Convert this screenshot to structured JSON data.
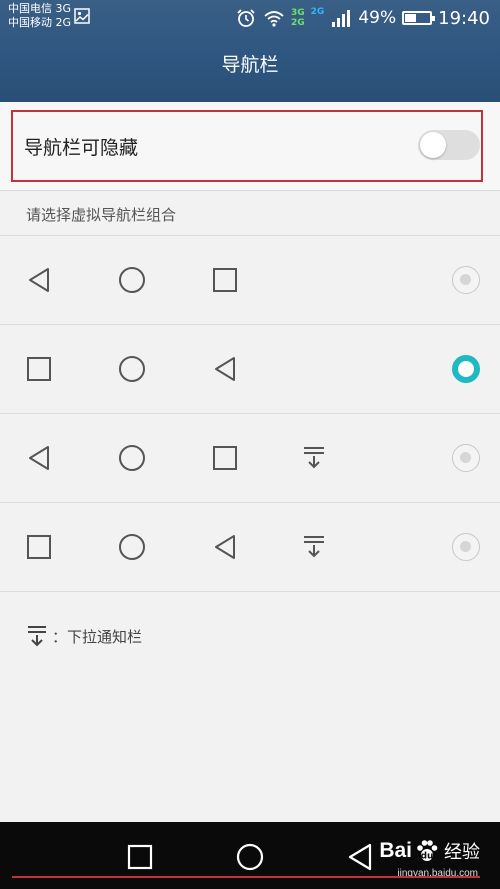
{
  "status_bar": {
    "carrier_line1": "中国电信 3G",
    "carrier_line2": "中国移动 2G",
    "net_badge_top": "3G",
    "net_badge_bottom": "2G",
    "net_badge_side": "2G",
    "battery_percent": "49%",
    "battery_level": 0.49,
    "time": "19:40"
  },
  "header": {
    "title": "导航栏"
  },
  "hide_setting": {
    "label": "导航栏可隐藏",
    "enabled": false
  },
  "section": {
    "label": "请选择虚拟导航栏组合"
  },
  "options": [
    {
      "icons": [
        "back-icon",
        "home-icon",
        "recents-icon"
      ],
      "selected": false
    },
    {
      "icons": [
        "recents-icon",
        "home-icon",
        "back-icon"
      ],
      "selected": true
    },
    {
      "icons": [
        "back-icon",
        "home-icon",
        "recents-icon",
        "notification-pulldown-icon"
      ],
      "selected": false
    },
    {
      "icons": [
        "recents-icon",
        "home-icon",
        "back-icon",
        "notification-pulldown-icon"
      ],
      "selected": false
    }
  ],
  "legend": {
    "text": "：下拉通知栏"
  },
  "colors": {
    "accent": "#1fb9c4",
    "header": "#2f5781",
    "highlight": "#c0323c"
  },
  "watermark": {
    "brand": "Bai",
    "brand_suffix": "经验",
    "url": "jingyan.baidu.com"
  }
}
